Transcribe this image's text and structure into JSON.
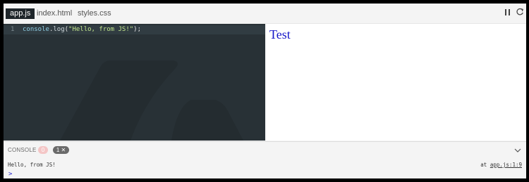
{
  "tabs": [
    {
      "label": "app.js",
      "active": true
    },
    {
      "label": "index.html",
      "active": false
    },
    {
      "label": "styles.css",
      "active": false
    }
  ],
  "toolbar": {
    "pause_icon": "pause-icon",
    "reload_icon": "reload-icon"
  },
  "editor": {
    "line_number": "1",
    "code": {
      "object": "console",
      "dot": ".",
      "method": "log",
      "open": "(",
      "string": "\"Hello, from JS!\"",
      "close": ");"
    }
  },
  "preview": {
    "text": "Test"
  },
  "console": {
    "title": "CONSOLE",
    "error_count": "0",
    "log_badge": "1 ✕",
    "message": "Hello, from JS!",
    "location_prefix": "at ",
    "location_link": "app.js:1:9",
    "prompt": ">"
  },
  "colors": {
    "editor_bg": "#283136",
    "preview_text": "#1515c8",
    "active_tab_bg": "#1f262b"
  }
}
